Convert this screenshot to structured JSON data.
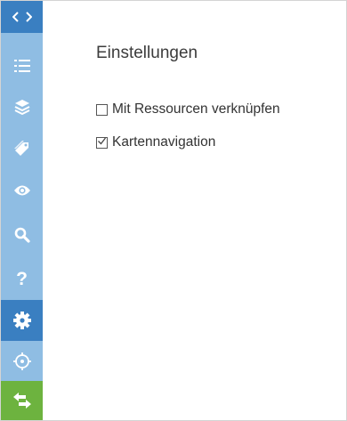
{
  "sidebar": {
    "items": [
      {
        "icon": "collapse-toggle-icon"
      },
      {
        "icon": "list-icon"
      },
      {
        "icon": "layers-icon"
      },
      {
        "icon": "tags-icon"
      },
      {
        "icon": "eye-icon"
      },
      {
        "icon": "search-icon"
      },
      {
        "icon": "help-icon",
        "label": "?"
      },
      {
        "icon": "gear-icon"
      },
      {
        "icon": "crosshair-icon"
      },
      {
        "icon": "swap-arrows-icon"
      }
    ]
  },
  "panel": {
    "title": "Einstellungen",
    "options": [
      {
        "label": "Mit Ressourcen verknüpfen",
        "checked": false
      },
      {
        "label": "Kartennavigation",
        "checked": true
      }
    ]
  },
  "colors": {
    "sidebar_bg": "#8fbde3",
    "sidebar_active": "#3a7fc1",
    "sidebar_green": "#6db33f"
  }
}
